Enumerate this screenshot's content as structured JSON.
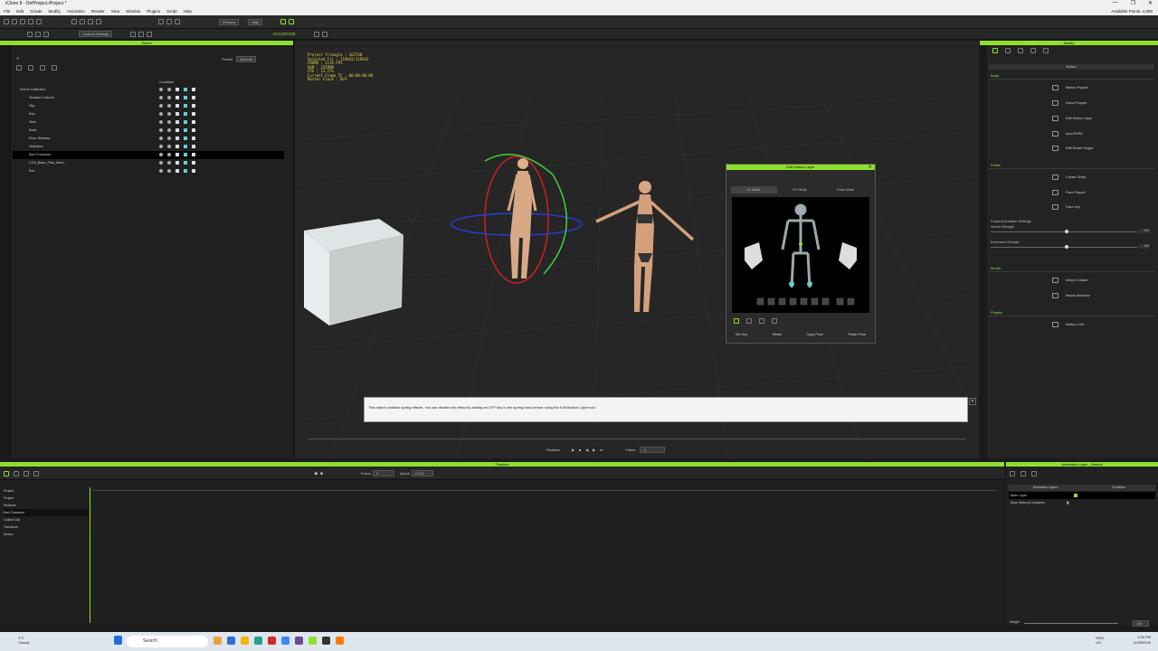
{
  "window": {
    "title": "iClone 8 - DefProject.iProject *",
    "controls": [
      "—",
      "❐",
      "✕"
    ]
  },
  "menu": {
    "items": [
      "File",
      "Edit",
      "Create",
      "Modify",
      "Animation",
      "Render",
      "View",
      "Window",
      "Plugins",
      "Script",
      "Help"
    ],
    "points_label": "Available Points: 4,000"
  },
  "toolbar": {
    "custom_settings": "Custom Settings",
    "preview": "Preview",
    "quality": "High",
    "accupose": "ACCUPOSE"
  },
  "scene": {
    "title": "Scene",
    "preset_label": "Preset",
    "preset_value": "General",
    "condition_label": "Condition",
    "items": [
      {
        "label": "Scene Collection",
        "indent": 0
      },
      {
        "label": "Shadow Catcher",
        "indent": 1
      },
      {
        "label": "Sky",
        "indent": 1
      },
      {
        "label": "Key",
        "indent": 1
      },
      {
        "label": "Side",
        "indent": 1
      },
      {
        "label": "Back",
        "indent": 1
      },
      {
        "label": "Floor Shadow",
        "indent": 1
      },
      {
        "label": "Selection",
        "indent": 1
      },
      {
        "label": "Bad Character",
        "indent": 1
      },
      {
        "label": "CC5_Base_Plus_Neut_",
        "indent": 1
      },
      {
        "label": "Box",
        "indent": 1
      }
    ]
  },
  "viewport": {
    "info": [
      "Project Triangle : 162760",
      "Selected Tri : 119642/119642",
      "FRAME : 1176 FPS",
      "RAM : 2359MB",
      "CPU : 13.27%",
      "Current Frame TC : 00:00:00:00",
      "Master Clock : N/A"
    ],
    "notice": "This object contains spring effects.  You can disable the effect by adding an OFF key in the spring track before using the Edit Motion Layer tool.",
    "playback": {
      "mode": "Realtime",
      "frame_label": "Frame",
      "frame_value": "0"
    }
  },
  "edit_motion_layer": {
    "title": "Edit Motion Layer",
    "tabs": [
      "IK Mode",
      "FK Mode",
      "Pose Mode"
    ],
    "buttons": [
      "Set Key",
      "Reset",
      "Copy Pose",
      "Paste Pose"
    ]
  },
  "modify": {
    "title": "Modify",
    "section_header": "Motion",
    "sections": [
      {
        "name": "Body",
        "items": [
          "Motion Puppet",
          "Direct Puppet",
          "Edit Motion Layer",
          "AccuPOSE",
          "Edit Reach Target"
        ]
      },
      {
        "name": "Facial",
        "items": [
          "Create Script",
          "Face Puppet",
          "Face Key"
        ]
      },
      {
        "name": "Morph",
        "items": [
          "Morph Creator",
          "Morph Animator"
        ]
      },
      {
        "name": "Plugins",
        "items": [
          "Motion LIVE"
        ]
      }
    ],
    "facial_settings": {
      "label": "Facial Animation Settings",
      "sliders": [
        {
          "label": "Viseme Strength",
          "value": "100"
        },
        {
          "label": "Expression Strength",
          "value": "100"
        }
      ]
    }
  },
  "timeline": {
    "title": "Timeline",
    "frame_label": "Frame",
    "frame_value": "0",
    "speed_label": "Speed",
    "speed_value": "x1.00",
    "tracks": [
      "Project",
      "Project",
      "Switcher",
      "Bad Character",
      "Collect Clip",
      "Transform",
      "Motion"
    ]
  },
  "animation_layer": {
    "title": "Animation Layer - Default",
    "col_layers": "Animation Layers",
    "col_condition": "Condition",
    "rows": [
      "Base Layer",
      "Base Motion(Complete)"
    ],
    "weight_label": "Weight",
    "weight_value": "100"
  },
  "taskbar": {
    "temp": "1°C",
    "weather": "Cloudy",
    "search": "Search",
    "lang1": "ENG",
    "lang2": "US",
    "time": "1:29 PM",
    "date": "11/28/2025"
  },
  "colors": {
    "accent": "#8ee02e",
    "info_text": "#e0d846"
  }
}
